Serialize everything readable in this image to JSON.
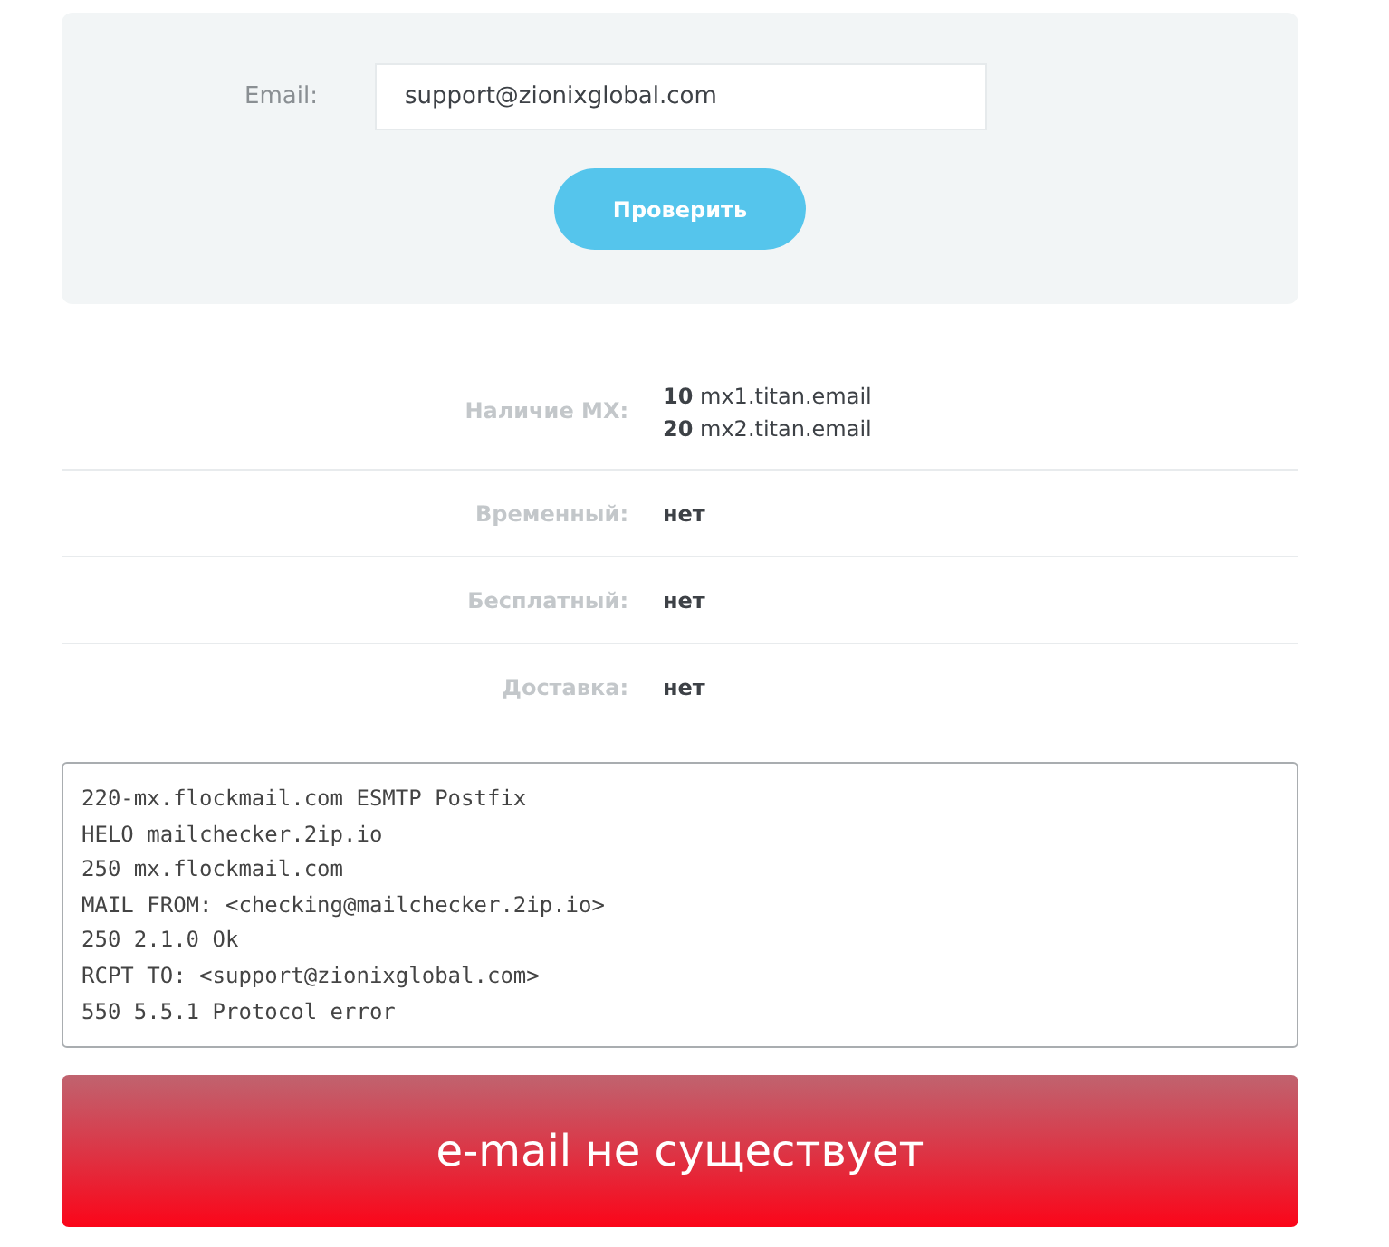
{
  "form": {
    "label": "Email:",
    "value": "support@zionixglobal.com",
    "button": "Проверить"
  },
  "results": [
    {
      "label": "Наличие MX:",
      "lines": [
        "**10** mx1.titan.email",
        "**20** mx2.titan.email"
      ]
    },
    {
      "label": "Временный:",
      "lines": [
        "**нет**"
      ]
    },
    {
      "label": "Бесплатный:",
      "lines": [
        "**нет**"
      ]
    },
    {
      "label": "Доставка:",
      "lines": [
        "**нет**"
      ]
    }
  ],
  "log": [
    "220-mx.flockmail.com ESMTP Postfix",
    "HELO mailchecker.2ip.io",
    "250 mx.flockmail.com",
    "MAIL FROM: <checking@mailchecker.2ip.io>",
    "250 2.1.0 Ok",
    "RCPT TO: <support@zionixglobal.com>",
    "550 5.5.1 Protocol error"
  ],
  "verdict": {
    "kind": "error",
    "text": "e-mail не существует"
  }
}
